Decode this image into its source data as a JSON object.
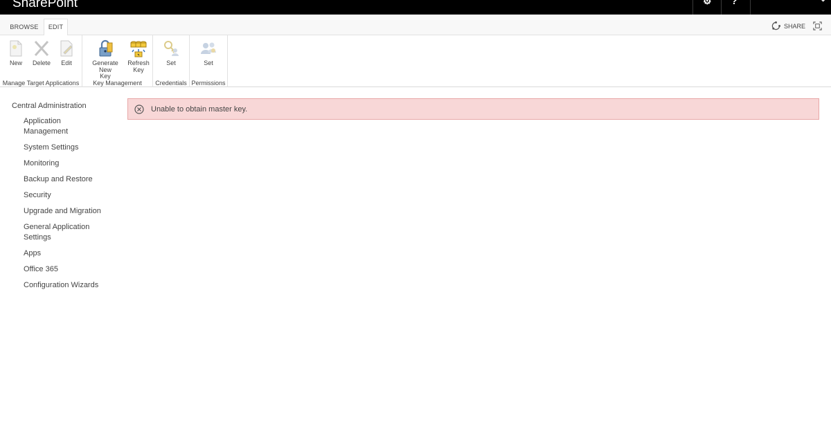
{
  "suitebar": {
    "brand": "SharePoint",
    "gear_glyph": "⚙",
    "help_glyph": "?",
    "user_glyph": "⌄"
  },
  "tabs": {
    "browse": "BROWSE",
    "edit": "EDIT",
    "share": "SHARE"
  },
  "ribbon": {
    "groups": [
      {
        "label": "Manage Target Applications",
        "buttons": [
          "New",
          "Delete",
          "Edit"
        ]
      },
      {
        "label": "Key Management",
        "buttons": [
          "Generate New Key",
          "Refresh Key"
        ]
      },
      {
        "label": "Credentials",
        "buttons": [
          "Set"
        ]
      },
      {
        "label": "Permissions",
        "buttons": [
          "Set"
        ]
      }
    ],
    "btn_new": "New",
    "btn_delete": "Delete",
    "btn_edit": "Edit",
    "btn_generate_line1": "Generate New",
    "btn_generate_line2": "Key",
    "btn_refresh_line1": "Refresh",
    "btn_refresh_line2": "Key",
    "btn_credentials_set": "Set",
    "btn_permissions_set": "Set",
    "group_manage": "Manage Target Applications",
    "group_key": "Key Management",
    "group_credentials": "Credentials",
    "group_permissions": "Permissions"
  },
  "nav": {
    "root": "Central Administration",
    "items": [
      "Application Management",
      "System Settings",
      "Monitoring",
      "Backup and Restore",
      "Security",
      "Upgrade and Migration",
      "General Application Settings",
      "Apps",
      "Office 365",
      "Configuration Wizards"
    ]
  },
  "error": {
    "message": "Unable to obtain master key.",
    "icon": "error-circle-icon"
  },
  "colors": {
    "suitebar": "#000000",
    "error_bg": "#f8d7d7",
    "error_border": "#e8a8a8",
    "text": "#444444"
  }
}
